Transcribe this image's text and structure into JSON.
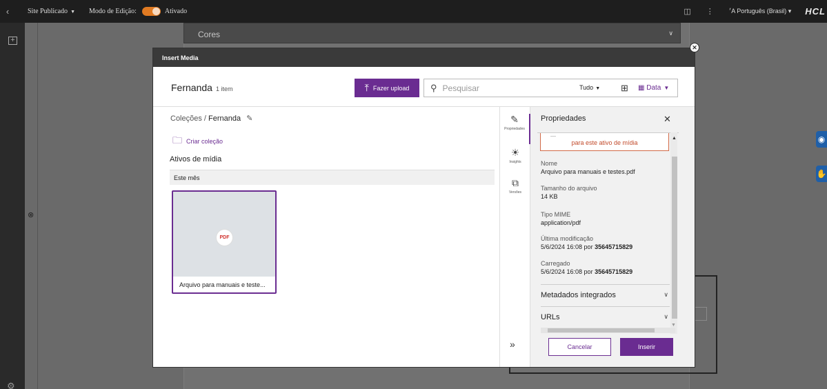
{
  "topbar": {
    "back_icon": "chevron-left-icon",
    "site_status": "Site Publicado",
    "edit_mode_label": "Modo de Edição:",
    "edit_mode_value": "Ativado",
    "toggle_color": "#e07a22",
    "language": "Português (Brasil)",
    "logo": "HCL"
  },
  "background": {
    "cores_label": "Cores"
  },
  "modal": {
    "header": "Insert Media",
    "collection_name": "Fernanda",
    "item_count": "1 item",
    "upload_label": "Fazer upload",
    "search_placeholder": "Pesquisar",
    "filter_value": "Tudo",
    "sort_value": "Data",
    "breadcrumb_root": "Coleções",
    "breadcrumb_sep": "/",
    "breadcrumb_current": "Fernanda",
    "create_collection": "Criar coleção",
    "assets_heading": "Ativos de mídia",
    "month_group": "Este mês",
    "asset": {
      "type_badge": "PDF",
      "name": "Arquivo para manuais e teste..."
    },
    "rail_tabs": [
      {
        "label": "Propriedades",
        "icon": "properties-icon"
      },
      {
        "label": "Insights",
        "icon": "insights-icon"
      },
      {
        "label": "Versões",
        "icon": "versions-icon"
      }
    ],
    "accent_color": "#6a2c91"
  },
  "properties": {
    "title": "Propriedades",
    "warning_text": "para este ativo de mídia",
    "fields": {
      "name_label": "Nome",
      "name_value": "Arquivo para manuais e testes.pdf",
      "size_label": "Tamanho do arquivo",
      "size_value": "14 KB",
      "mime_label": "Tipo MIME",
      "mime_value": "application/pdf",
      "modified_label": "Última modificação",
      "modified_date": "5/6/2024 16:08 por",
      "modified_by": "35645715829",
      "uploaded_label": "Carregado",
      "uploaded_date": "5/6/2024 16:08 por",
      "uploaded_by": "35645715829"
    },
    "accordions": {
      "metadata": "Metadados integrados",
      "urls": "URLs"
    },
    "cancel_label": "Cancelar",
    "insert_label": "Inserir"
  }
}
